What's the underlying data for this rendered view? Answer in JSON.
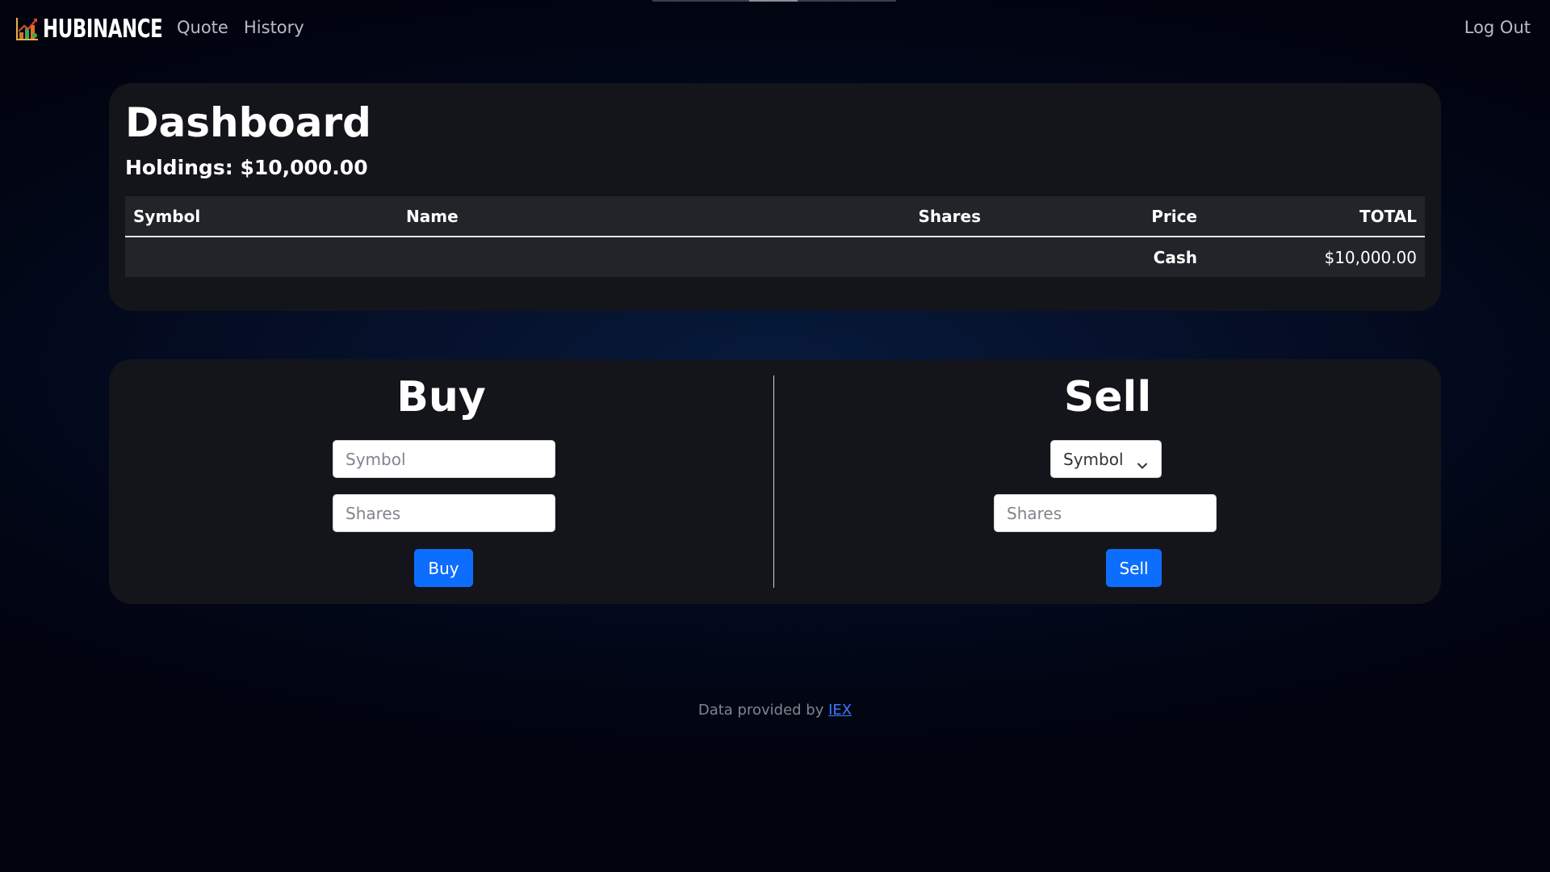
{
  "nav": {
    "brand": "HUBINANCE",
    "links": [
      "Quote",
      "History"
    ],
    "logout": "Log Out"
  },
  "dashboard": {
    "title": "Dashboard",
    "holdings_label": "Holdings:",
    "holdings_value": "$10,000.00",
    "table": {
      "headers": [
        "Symbol",
        "Name",
        "Shares",
        "Price",
        "TOTAL"
      ],
      "cash_row": {
        "label": "Cash",
        "total": "$10,000.00"
      }
    }
  },
  "buy": {
    "title": "Buy",
    "symbol_placeholder": "Symbol",
    "shares_placeholder": "Shares",
    "button": "Buy"
  },
  "sell": {
    "title": "Sell",
    "symbol_select": "Symbol",
    "shares_placeholder": "Shares",
    "button": "Sell"
  },
  "footer": {
    "text": "Data provided by",
    "link": "IEX"
  },
  "colors": {
    "accent": "#0d6efd",
    "card": "#13151b",
    "table_row": "#212429"
  },
  "icons": {
    "brand": "stock-chart-icon",
    "select_arrow": "chevron-down-icon"
  }
}
